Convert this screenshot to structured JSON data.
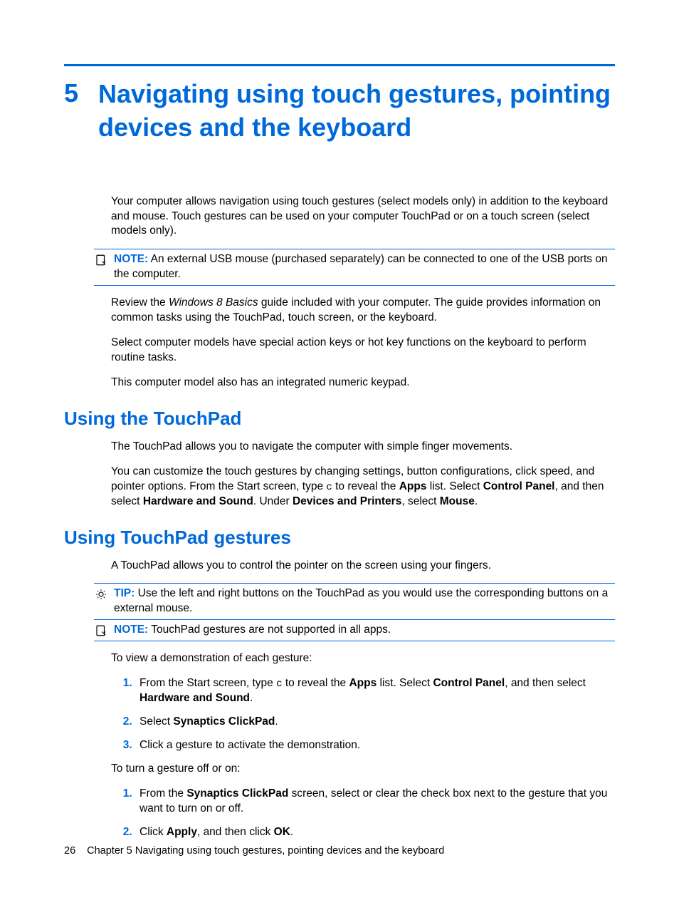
{
  "chapter": {
    "number": "5",
    "title": "Navigating using touch gestures, pointing devices and the keyboard"
  },
  "intro": {
    "p1": "Your computer allows navigation using touch gestures (select models only) in addition to the keyboard and mouse. Touch gestures can be used on your computer TouchPad or on a touch screen (select models only).",
    "note1_label": "NOTE:",
    "note1": "An external USB mouse (purchased separately) can be connected to one of the USB ports on the computer.",
    "p2_a": "Review the ",
    "p2_i": "Windows 8 Basics",
    "p2_b": " guide included with your computer. The guide provides information on common tasks using the TouchPad, touch screen, or the keyboard.",
    "p3": "Select computer models have special action keys or hot key functions on the keyboard to perform routine tasks.",
    "p4": "This computer model also has an integrated numeric keypad."
  },
  "sections": {
    "touchpad": {
      "heading": "Using the TouchPad",
      "p1": "The TouchPad allows you to navigate the computer with simple finger movements.",
      "p2_a": "You can customize the touch gestures by changing settings, button configurations, click speed, and pointer options. From the Start screen, type ",
      "p2_m": "c",
      "p2_b": " to reveal the ",
      "p2_s1": "Apps",
      "p2_c": " list. Select ",
      "p2_s2": "Control Panel",
      "p2_d": ", and then select ",
      "p2_s3": "Hardware and Sound",
      "p2_e": ". Under ",
      "p2_s4": "Devices and Printers",
      "p2_f": ", select ",
      "p2_s5": "Mouse",
      "p2_g": "."
    },
    "gestures": {
      "heading": "Using TouchPad gestures",
      "p1": "A TouchPad allows you to control the pointer on the screen using your fingers.",
      "tip_label": "TIP:",
      "tip": "Use the left and right buttons on the TouchPad as you would use the corresponding buttons on a external mouse.",
      "note_label": "NOTE:",
      "note": "TouchPad gestures are not supported in all apps.",
      "demo_intro": "To view a demonstration of each gesture:",
      "demo_steps": {
        "s1_a": "From the Start screen, type ",
        "s1_m": "c",
        "s1_b": " to reveal the ",
        "s1_s1": "Apps",
        "s1_c": " list. Select ",
        "s1_s2": "Control Panel",
        "s1_d": ", and then select ",
        "s1_s3": "Hardware and Sound",
        "s1_e": ".",
        "s2_a": "Select ",
        "s2_s1": "Synaptics ClickPad",
        "s2_b": ".",
        "s3": "Click a gesture to activate the demonstration."
      },
      "toggle_intro": "To turn a gesture off or on:",
      "toggle_steps": {
        "s1_a": "From the ",
        "s1_s1": "Synaptics ClickPad",
        "s1_b": " screen, select or clear the check box next to the gesture that you want to turn on or off.",
        "s2_a": "Click ",
        "s2_s1": "Apply",
        "s2_b": ", and then click ",
        "s2_s2": "OK",
        "s2_c": "."
      }
    }
  },
  "footer": {
    "page": "26",
    "text": "Chapter 5   Navigating using touch gestures, pointing devices and the keyboard"
  }
}
